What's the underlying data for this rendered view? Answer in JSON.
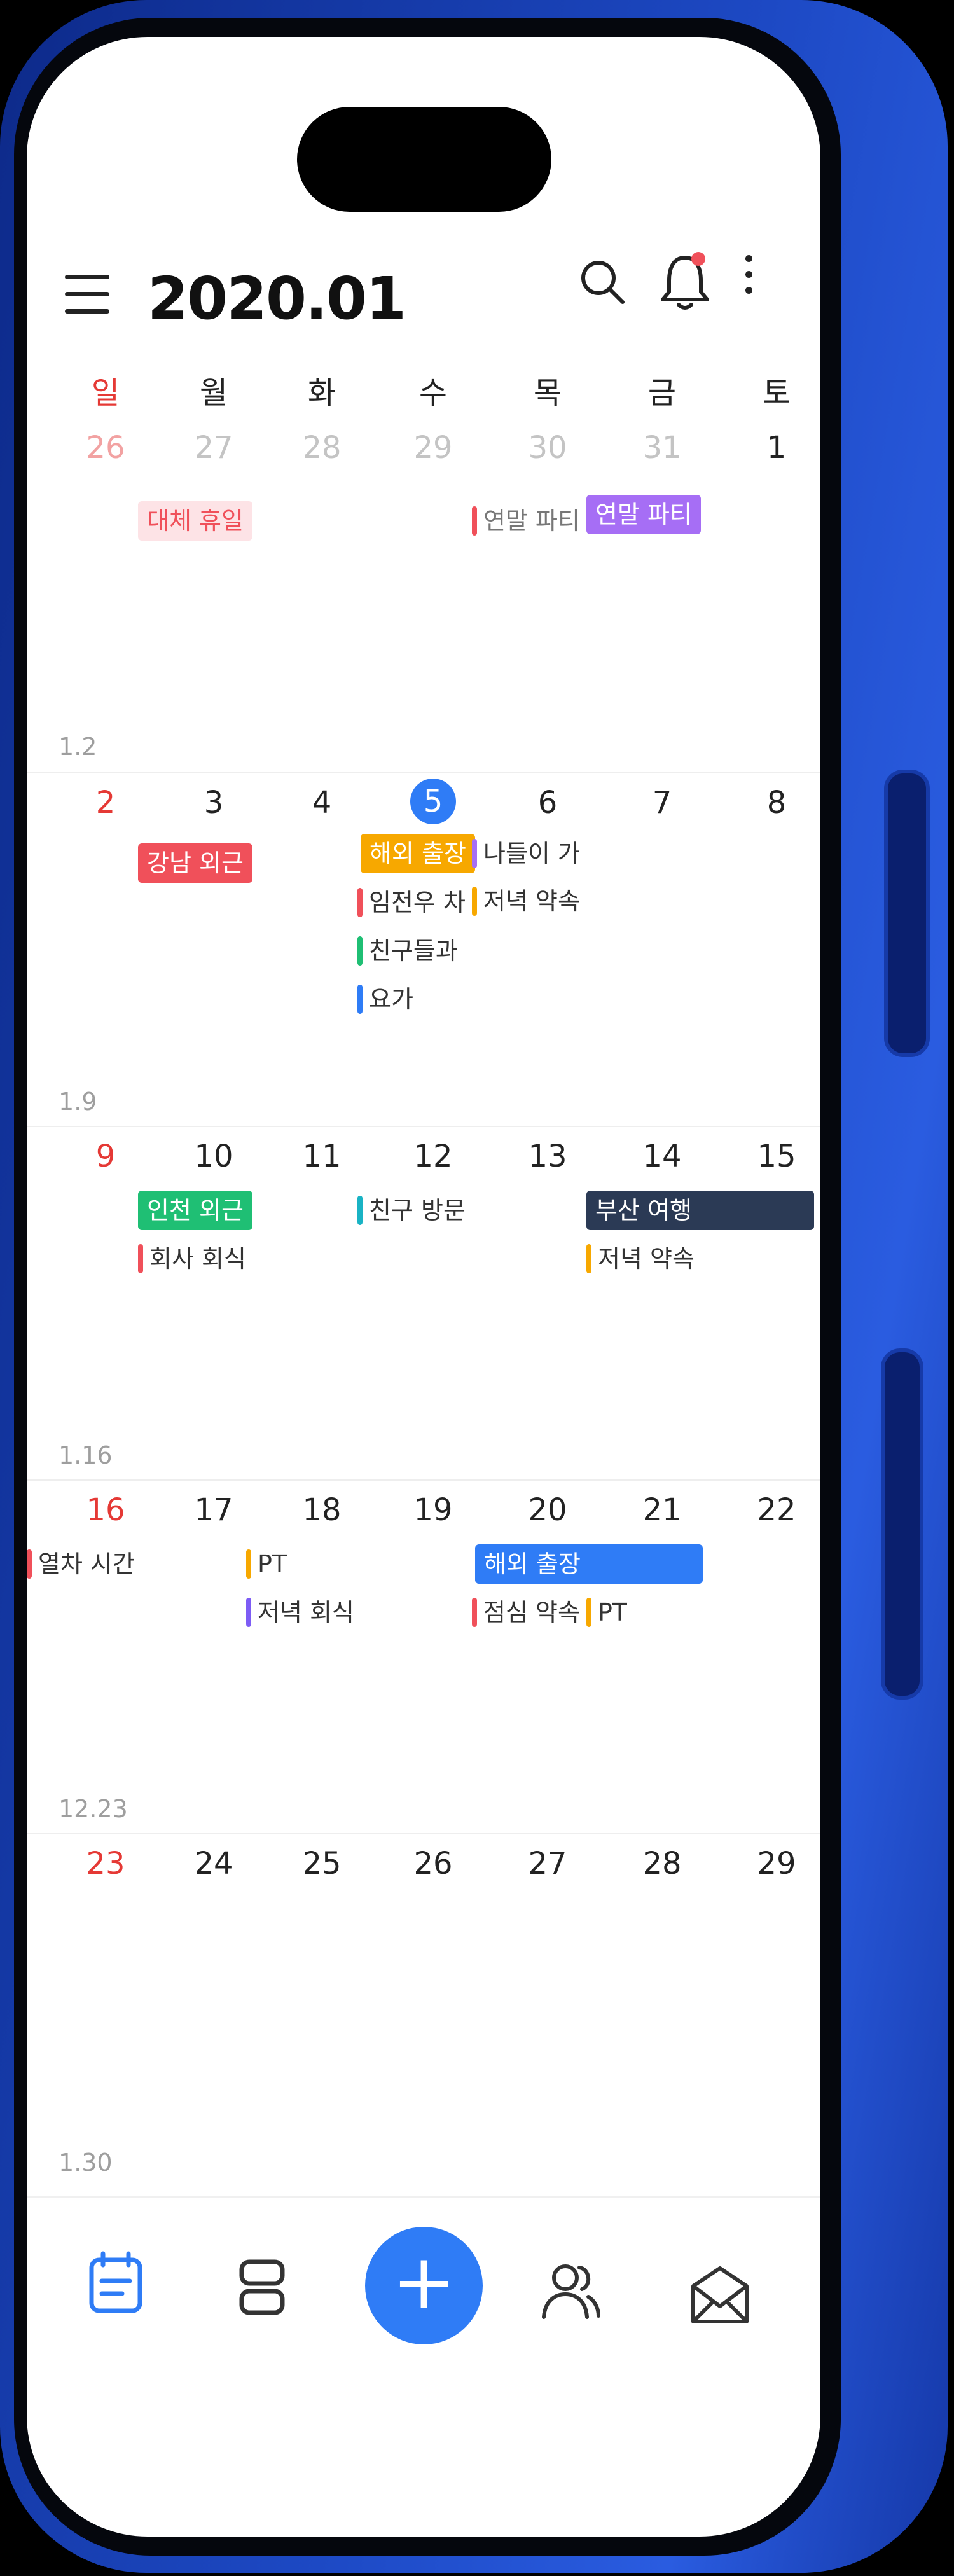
{
  "header": {
    "title": "2020.01"
  },
  "weekdays": [
    "일",
    "월",
    "화",
    "수",
    "목",
    "금",
    "토"
  ],
  "colors": {
    "red": "#f0505a",
    "purple": "#a66ef5",
    "orange": "#f7a800",
    "green": "#1fbf74",
    "blue": "#2f7cf6",
    "teal": "#19b3c4",
    "navy": "#2b3a55",
    "pink": "#fde3e6",
    "violet": "#7d5cf5"
  },
  "weeks": [
    {
      "days": [
        "26",
        "27",
        "28",
        "29",
        "30",
        "31",
        "1"
      ],
      "label": "1.2"
    },
    {
      "days": [
        "2",
        "3",
        "4",
        "5",
        "6",
        "7",
        "8"
      ],
      "label": "1.9"
    },
    {
      "days": [
        "9",
        "10",
        "11",
        "12",
        "13",
        "14",
        "15"
      ],
      "label": "1.16"
    },
    {
      "days": [
        "16",
        "17",
        "18",
        "19",
        "20",
        "21",
        "22"
      ],
      "label": "12.23"
    },
    {
      "days": [
        "23",
        "24",
        "25",
        "26",
        "27",
        "28",
        "29"
      ],
      "label": "1.30"
    }
  ],
  "events": {
    "w1_holiday": "대체 휴일",
    "w1_party_a": "연말 파티",
    "w1_party_b": "연말 파티",
    "w2_gangnam": "강남 외근",
    "w2_trip": "해외 출장",
    "w2_outing": "나들이 가",
    "w2_dinner": "저녁 약속",
    "w2_limjeonwoo": "임전우 차",
    "w2_friends": "친구들과",
    "w2_yoga": "요가",
    "w3_incheon": "인천 외근",
    "w3_office_dinner": "회사 회식",
    "w3_friend_visit": "친구 방문",
    "w3_busan": "부산 여행",
    "w3_dinner": "저녁 약속",
    "w4_train": "열차 시간",
    "w4_pt": "PT",
    "w4_evening_dinner": "저녁 회식",
    "w4_trip": "해외 출장",
    "w4_lunch": "점심 약속",
    "w4_pt2": "PT"
  },
  "tabbar": {
    "add_label": "+",
    "items": [
      "calendar-icon",
      "list-icon",
      "add-icon",
      "people-icon",
      "mail-icon"
    ]
  }
}
